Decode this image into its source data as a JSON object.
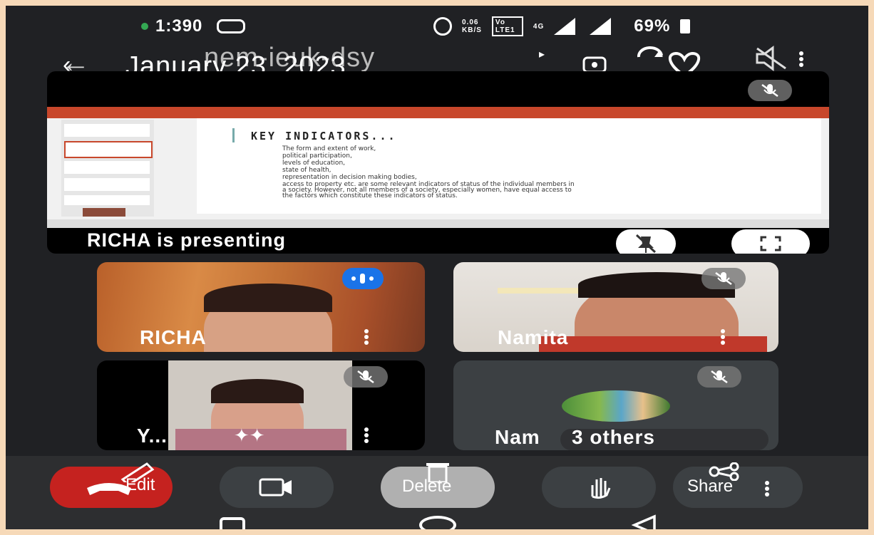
{
  "status_bar": {
    "time": "1:390",
    "speed_value": "0.06",
    "speed_unit": "KB/S",
    "network_badge": "Vo LTE1",
    "signal_type": "4G",
    "battery": "69%"
  },
  "meeting": {
    "meeting_code": "nem-ieuk-dsy",
    "date_overlay": "January 23, 2023"
  },
  "presentation": {
    "slide_title": "KEY INDICATORS...",
    "slide_lines": [
      "The form and extent of work,",
      "political participation,",
      " levels of education,",
      "state of health,",
      "representation in decision making bodies,",
      "access to property etc. are some relevant indicators of status of the individual members in",
      "a society. However, not all members of a society, especially women, have equal access to",
      "the factors which constitute these indicators of status."
    ],
    "presenting_label": "RICHA is presenting"
  },
  "participants": [
    {
      "name": "RICHA"
    },
    {
      "name": "Namita"
    },
    {
      "name": "Y..."
    },
    {
      "name": "Nam"
    },
    {
      "name": "3 others"
    }
  ],
  "overlay_labels": {
    "edit": "Edit",
    "delete": "Delete",
    "share": "Share"
  },
  "colors": {
    "end_call_red": "#c5221f",
    "speaking_blue": "#1a73e8",
    "background": "#202124",
    "tile": "#3c4043",
    "ppt_orange": "#c8472b"
  }
}
